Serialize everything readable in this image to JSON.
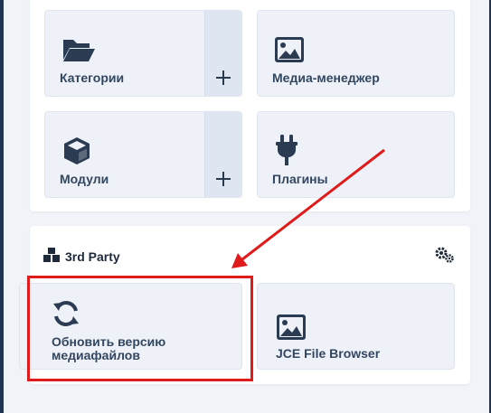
{
  "tiles": {
    "categories": {
      "label": "Категории",
      "icon": "folder-open-icon",
      "has_add": true
    },
    "media_manager": {
      "label": "Медиа-менеджер",
      "icon": "image-icon"
    },
    "modules": {
      "label": "Модули",
      "icon": "cube-icon",
      "has_add": true
    },
    "plugins": {
      "label": "Плагины",
      "icon": "plug-icon"
    }
  },
  "third_party": {
    "title": "3rd Party",
    "title_icon": "cubes-icon",
    "options_icon": "cogs-icon",
    "tiles": [
      {
        "label_line1": "Обновить версию",
        "label_line2": "медиафайлов",
        "icon": "sync-icon"
      },
      {
        "label": "JCE File Browser",
        "icon": "image-icon"
      }
    ]
  },
  "annotation": {
    "highlight_color": "#e01b1b"
  },
  "colors": {
    "tile_bg": "#eef2f8",
    "tile_add_zone": "#dde6f1",
    "icon": "#23324a",
    "sidebar": "#1f3454"
  }
}
